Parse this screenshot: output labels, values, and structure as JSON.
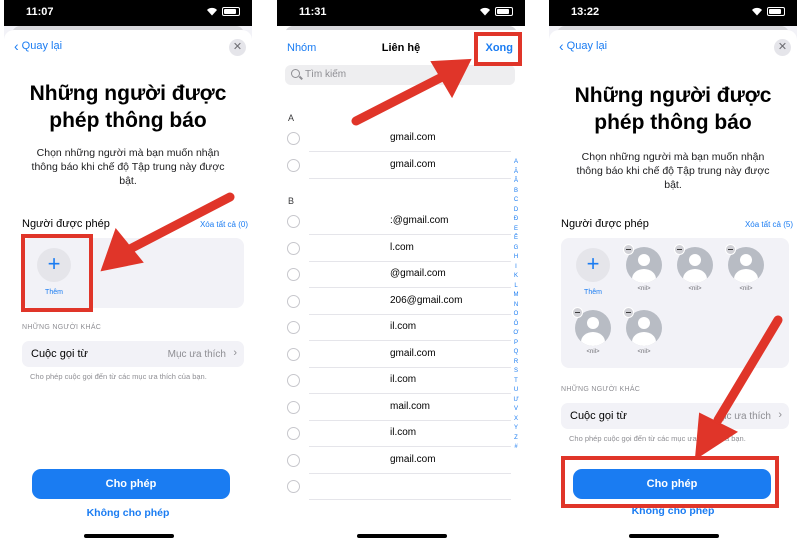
{
  "status_times": [
    "11:07",
    "11:31",
    "13:22"
  ],
  "sheet": {
    "back_label": "Quay lại",
    "title": "Những người được phép thông báo",
    "subtitle": "Chọn những người mà bạn muốn nhận thông báo khi chế độ Tập trung này được bật.",
    "allowed_label": "Người được phép",
    "add_label": "Thêm",
    "others_label": "NHỮNG NGƯỜI KHÁC",
    "calls_label": "Cuộc gọi từ",
    "calls_value": "Mục ưa thích",
    "calls_note": "Cho phép cuộc gọi đến từ các mục ưa thích của bạn.",
    "allow_button": "Cho phép",
    "deny_button": "Không cho phép"
  },
  "screen1": {
    "clear_all": "Xóa tất cả (0)"
  },
  "screen3": {
    "clear_all": "Xóa tất cả (5)",
    "calls_value_partial": "ục ưa thích",
    "contacts": [
      "<nil>",
      "<nil>",
      "<nil>",
      "<nil>",
      "<nil>"
    ]
  },
  "contacts_picker": {
    "nav_left": "Nhóm",
    "nav_title": "Liên hệ",
    "nav_right": "Xong",
    "search_placeholder": "Tìm kiếm",
    "sections": [
      {
        "letter": "A",
        "emails": [
          "gmail.com",
          "gmail.com"
        ]
      },
      {
        "letter": "B",
        "emails": [
          ":@gmail.com",
          "l.com",
          "@gmail.com",
          "206@gmail.com",
          "il.com",
          "gmail.com",
          "il.com",
          "mail.com",
          "il.com",
          "gmail.com",
          ""
        ]
      }
    ],
    "index": [
      "A",
      "Ă",
      "Â",
      "B",
      "C",
      "D",
      "Đ",
      "E",
      "Ê",
      "G",
      "H",
      "I",
      "K",
      "L",
      "M",
      "N",
      "O",
      "Ô",
      "Ơ",
      "P",
      "Q",
      "R",
      "S",
      "T",
      "U",
      "Ư",
      "V",
      "X",
      "Y",
      "Z",
      "#"
    ]
  },
  "colors": {
    "accent": "#1a7cf2",
    "annotation": "#e03529"
  }
}
